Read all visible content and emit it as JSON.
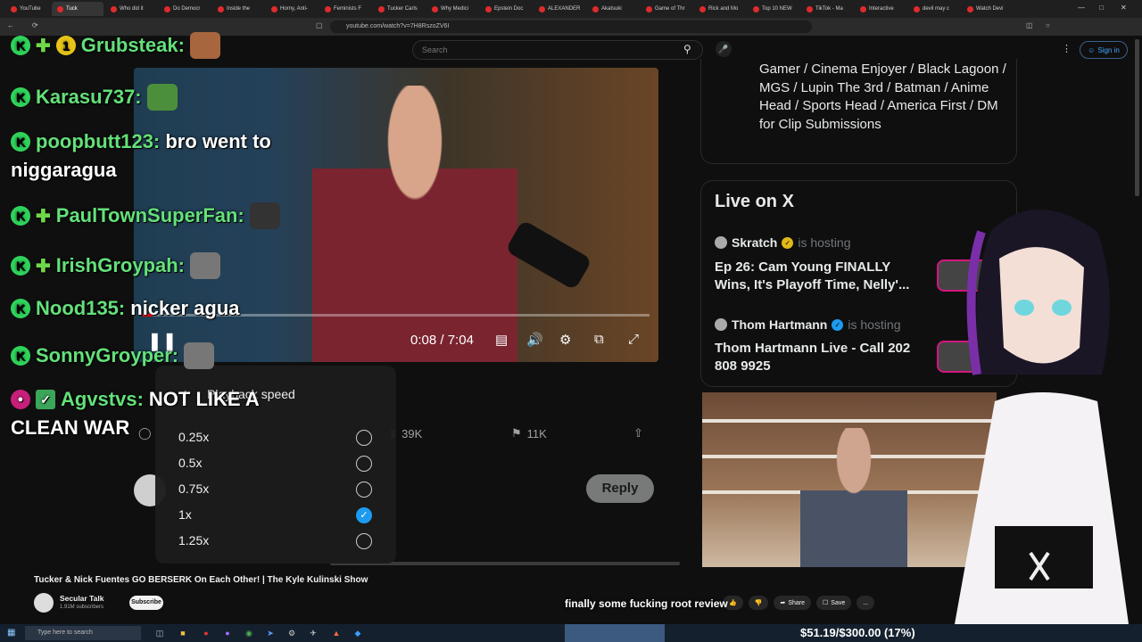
{
  "browser": {
    "tabs": [
      {
        "label": "YouTube",
        "active": false
      },
      {
        "label": "Tuck",
        "active": true
      },
      {
        "label": "Who did it",
        "active": false
      },
      {
        "label": "Do Democr",
        "active": false
      },
      {
        "label": "Inside the",
        "active": false
      },
      {
        "label": "Horny, Anti-",
        "active": false
      },
      {
        "label": "Feminists F",
        "active": false
      },
      {
        "label": "Tucker Carls",
        "active": false
      },
      {
        "label": "Why Medici",
        "active": false
      },
      {
        "label": "Epstein Doc",
        "active": false
      },
      {
        "label": "ALEXANDER",
        "active": false
      },
      {
        "label": "Akatsuki",
        "active": false
      },
      {
        "label": "Game of Thr",
        "active": false
      },
      {
        "label": "Rick and Mo",
        "active": false
      },
      {
        "label": "Top 10 NEW",
        "active": false
      },
      {
        "label": "TikTok - Ma",
        "active": false
      },
      {
        "label": "Interactive",
        "active": false
      },
      {
        "label": "devil may c",
        "active": false
      },
      {
        "label": "Watch Devi",
        "active": false
      }
    ],
    "url": "youtube.com/watch?v=7H8RszoZV6I"
  },
  "youtube": {
    "search_placeholder": "Search",
    "signin_label": "Sign in",
    "video": {
      "time_current": "0:08",
      "time_total": "7:04",
      "time_separator": " / ",
      "progress": 0.019
    },
    "title": "Tucker & Nick Fuentes GO BERSERK On Each Other! | The Kyle Kulinski Show",
    "channel": "Secular Talk",
    "subscribers": "1.91M subscribers",
    "subscribe_label": "Subscribe",
    "actions": {
      "share": "Share",
      "save": "Save",
      "more": "..."
    }
  },
  "speed_menu": {
    "title": "Playback speed",
    "options": [
      {
        "label": "0.25x",
        "selected": false
      },
      {
        "label": "0.5x",
        "selected": false
      },
      {
        "label": "0.75x",
        "selected": false
      },
      {
        "label": "1x",
        "selected": true
      },
      {
        "label": "1.25x",
        "selected": false
      }
    ]
  },
  "tweet": {
    "stat_views": "39K",
    "stat_bookmarks": "11K",
    "reply_label": "Reply"
  },
  "chat": [
    {
      "user": "Grubsteak:",
      "message": ""
    },
    {
      "user": "Karasu737:",
      "message": ""
    },
    {
      "user": "poopbutt123:",
      "message": "bro went to",
      "continuation": "niggaragua"
    },
    {
      "user": "PaulTownSuperFan:",
      "message": ""
    },
    {
      "user": "IrishGroypah:",
      "message": ""
    },
    {
      "user": "Nood135:",
      "message": "nicker agua"
    },
    {
      "user": "SonnyGroyper:",
      "message": ""
    },
    {
      "user": "Agvstvs:",
      "message": "NOT LIKE A",
      "continuation": "CLEAN WAR"
    }
  ],
  "sidebar": {
    "bio": "Gamer / Cinema Enjoyer / Black Lagoon / MGS / Lupin The 3rd / Batman / Anime Head / Sports Head / America First / DM for Clip Submissions",
    "live_title": "Live on X",
    "hosts": [
      {
        "name": "Skratch",
        "hosting": "is hosting",
        "stream": "Ep 26: Cam Young FINALLY Wins, It's Playoff Time, Nelly'...",
        "verified_color": "#e2b719"
      },
      {
        "name": "Thom Hartmann",
        "hosting": "is hosting",
        "stream": "Thom Hartmann Live - Call 202 808 9925",
        "verified_color": "#1d9bf0"
      }
    ]
  },
  "overlay": {
    "text": "finally some fucking root review",
    "goal": "$51.19/$300.00 (17%)",
    "goal_progress": 0.17
  },
  "taskbar": {
    "search_placeholder": "Type here to search"
  },
  "colors": {
    "chat_username": "#64e07a",
    "accent_blue": "#1d9bf0",
    "youtube_red": "#ff0000"
  }
}
